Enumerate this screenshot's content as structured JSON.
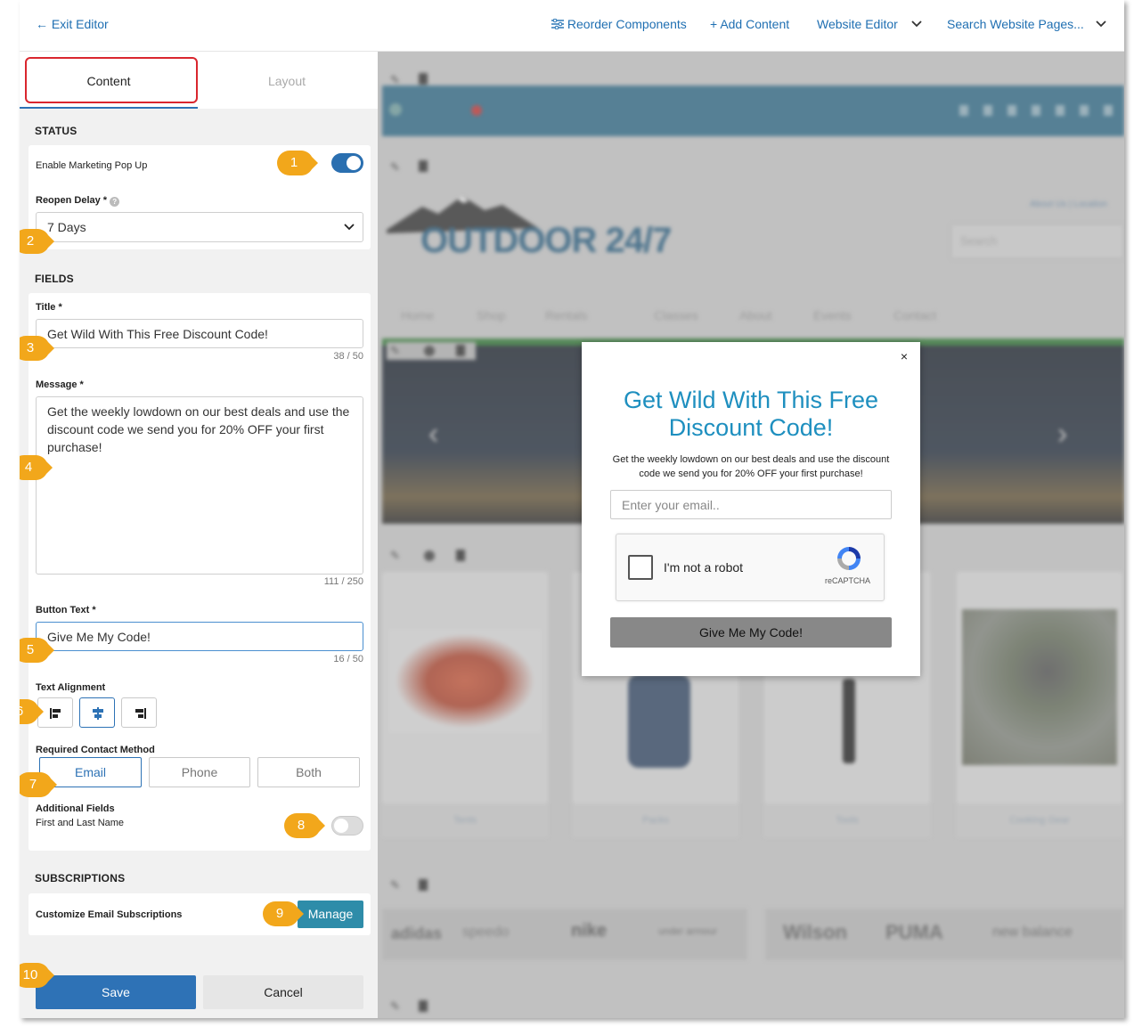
{
  "topbar": {
    "exit": "Exit Editor",
    "reorder": "Reorder Components",
    "add_content": "Add Content",
    "website_editor": "Website Editor",
    "search_pages": "Search Website Pages..."
  },
  "tabs": {
    "content": "Content",
    "layout": "Layout"
  },
  "status": {
    "heading": "STATUS",
    "enable_label": "Enable Marketing Pop Up",
    "enable_on": true,
    "reopen_label": "Reopen Delay *",
    "reopen_value": "7 Days"
  },
  "fields": {
    "heading": "FIELDS",
    "title_label": "Title *",
    "title_value": "Get Wild With This Free Discount Code!",
    "title_count": "38 / 50",
    "message_label": "Message *",
    "message_value": "Get the weekly lowdown on our best deals and use the discount code we send you for 20% OFF your first purchase!",
    "message_count": "111 / 250",
    "button_label": "Button Text *",
    "button_value": "Give Me My Code!",
    "button_count": "16 / 50",
    "alignment_label": "Text Alignment",
    "alignment_selected": "center",
    "contact_label": "Required Contact Method",
    "contact_options": [
      "Email",
      "Phone",
      "Both"
    ],
    "contact_selected": "Email",
    "additional_label": "Additional Fields",
    "additional_sub": "First and Last Name",
    "additional_on": false
  },
  "subscriptions": {
    "heading": "SUBSCRIPTIONS",
    "label": "Customize Email Subscriptions",
    "manage": "Manage"
  },
  "actions": {
    "save": "Save",
    "cancel": "Cancel"
  },
  "badges": [
    "1",
    "2",
    "3",
    "4",
    "5",
    "6",
    "7",
    "8",
    "9",
    "10"
  ],
  "popup": {
    "close": "×",
    "title": "Get Wild With This Free Discount Code!",
    "message": "Get the weekly lowdown on our best deals and use the discount code we send you for 20% OFF your first purchase!",
    "email_placeholder": "Enter your email..",
    "captcha_text": "I'm not a robot",
    "captcha_brand": "reCAPTCHA",
    "button": "Give Me My Code!"
  },
  "preview": {
    "logo": "OUTDOOR 24/7",
    "search_placeholder": "Search",
    "nav": [
      "Home",
      "Shop",
      "Rentals",
      "Classes",
      "About",
      "Events",
      "Contact"
    ],
    "top_links": "About Us  |  Location",
    "categories": [
      "Tents",
      "Packs",
      "Tools",
      "Cooking Gear"
    ],
    "brands": [
      "adidas",
      "speedo",
      "nike",
      "under armour",
      "Wilson",
      "PUMA",
      "new balance"
    ]
  },
  "colors": {
    "accent": "#2d72b5",
    "badge": "#f2a71b",
    "popup_title": "#1e8fbf",
    "manage": "#2e8ca9",
    "highlight": "#d9262e"
  }
}
